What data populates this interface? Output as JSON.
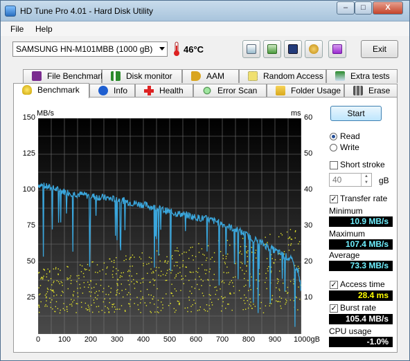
{
  "window": {
    "title": "HD Tune Pro 4.01 - Hard Disk Utility",
    "minimize": "–",
    "maximize": "□",
    "close": "X"
  },
  "menu": {
    "file": "File",
    "help": "Help"
  },
  "toolbar": {
    "drive": "SAMSUNG HN-M101MBB (1000 gB)",
    "temperature": "46°C",
    "exit_label": "Exit",
    "buttons": [
      "copy-info-icon",
      "copy-screenshot-icon",
      "save-icon",
      "settings-icon",
      "download-icon"
    ]
  },
  "tabs_top": [
    "File Benchmark",
    "Disk monitor",
    "AAM",
    "Random Access",
    "Extra tests"
  ],
  "tabs_bottom": [
    "Benchmark",
    "Info",
    "Health",
    "Error Scan",
    "Folder Usage",
    "Erase"
  ],
  "chart_data": {
    "type": "line",
    "ylabel_left": "MB/s",
    "ylabel_right": "ms",
    "xlabel": "gB",
    "x_ticks": [
      "0",
      "100",
      "200",
      "300",
      "400",
      "500",
      "600",
      "700",
      "800",
      "900",
      "1000gB"
    ],
    "y_left_ticks": [
      "150",
      "125",
      "100",
      "75",
      "50",
      "25"
    ],
    "y_right_ticks": [
      "60",
      "50",
      "40",
      "30",
      "20",
      "10"
    ],
    "ylim_left": [
      0,
      150
    ],
    "ylim_right": [
      0,
      60
    ],
    "xlim": [
      0,
      1000
    ],
    "grid": true,
    "series": [
      {
        "name": "Transfer rate",
        "unit": "MB/s",
        "color": "#3aa6dc",
        "x": [
          0,
          20,
          40,
          60,
          80,
          100,
          130,
          160,
          200,
          240,
          280,
          320,
          360,
          400,
          440,
          480,
          520,
          560,
          600,
          640,
          680,
          720,
          760,
          800,
          840,
          880,
          920,
          960,
          990,
          1000
        ],
        "y": [
          104,
          103,
          102,
          101,
          100,
          99,
          98,
          97,
          96,
          95,
          94,
          93,
          91,
          90,
          88,
          86,
          84,
          83,
          81,
          80,
          78,
          75,
          72,
          68,
          64,
          60,
          56,
          52,
          43,
          30
        ]
      },
      {
        "name": "Access time",
        "unit": "ms",
        "color": "#e8e82a",
        "x_range": [
          0,
          1000
        ],
        "y_range": [
          6,
          30
        ]
      }
    ]
  },
  "controls": {
    "start": "Start",
    "read": "Read",
    "write": "Write",
    "short_stroke": "Short stroke",
    "short_stroke_value": "40",
    "short_stroke_unit": "gB",
    "transfer_rate": "Transfer rate",
    "minimum_label": "Minimum",
    "minimum_value": "10.9 MB/s",
    "maximum_label": "Maximum",
    "maximum_value": "107.4 MB/s",
    "average_label": "Average",
    "average_value": "73.3 MB/s",
    "access_time": "Access time",
    "access_time_value": "28.4 ms",
    "burst_rate": "Burst rate",
    "burst_rate_value": "105.4 MB/s",
    "cpu_usage": "CPU usage",
    "cpu_usage_value": "-1.0%"
  },
  "colors": {
    "value_cyan": "#6ff0ff",
    "value_yellow": "#ffff00",
    "value_white": "#ffffff"
  }
}
